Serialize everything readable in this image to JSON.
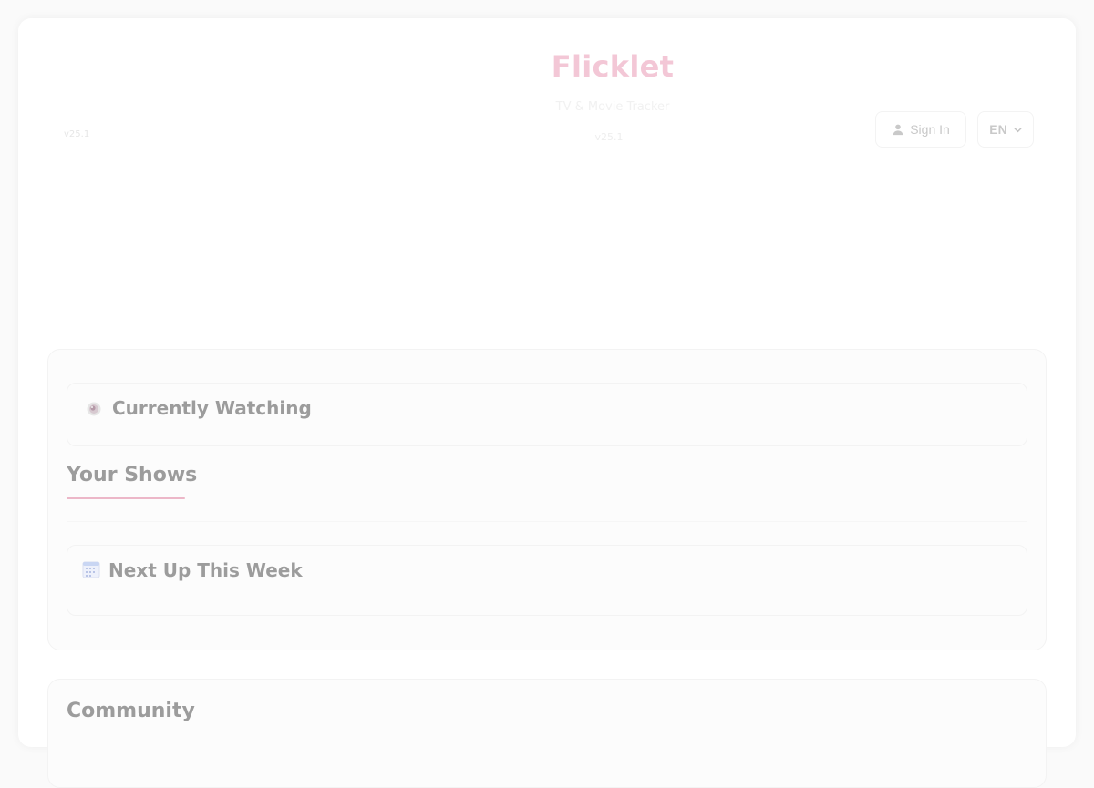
{
  "header": {
    "title": "Flicklet",
    "subtitle": "TV & Movie Tracker",
    "version_center": "v25.1",
    "version_left": "v25.1",
    "signin_label": "Sign In",
    "language_selected": "EN",
    "user_icon": "user-icon",
    "language_icon": "chevron-down-icon"
  },
  "main": {
    "currently_watching": {
      "icon": "eye-icon",
      "title": "Currently Watching"
    },
    "your_shows": {
      "heading": "Your Shows"
    },
    "next_up": {
      "icon": "calendar-icon",
      "title": "Next Up This Week"
    }
  },
  "community": {
    "heading": "Community"
  },
  "colors": {
    "brand_accent": "#f3c7d6",
    "underline_accent": "#ecb7c8",
    "heading_text": "#9c9c9c",
    "panel_bg": "#fcfcfc"
  }
}
